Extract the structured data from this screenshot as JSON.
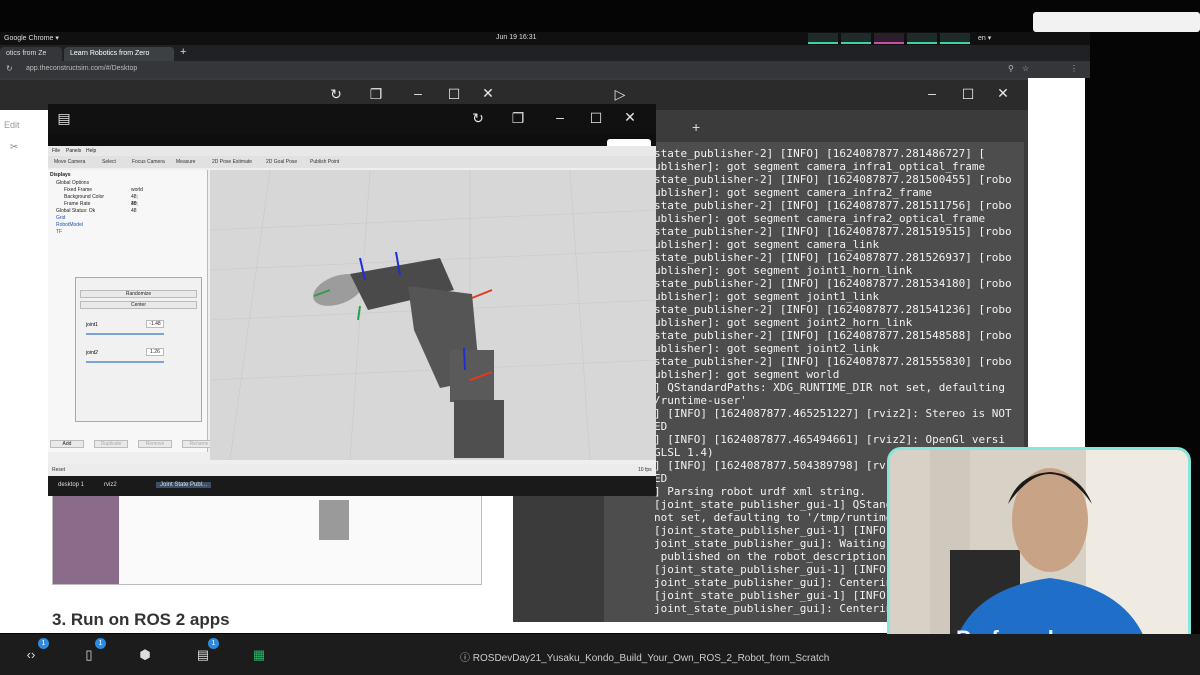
{
  "system": {
    "activities": "Google Chrome ▾",
    "clock": "Jun 19  16:31",
    "lang": "en ▾"
  },
  "browser": {
    "tabs": [
      {
        "label": "otics from Ze"
      },
      {
        "label": "Learn Robotics from Zero"
      }
    ],
    "url": "app.theconstructsim.com/#/Desktop"
  },
  "doc": {
    "edit_label": "Edit",
    "heading": "3. Run on ROS 2 apps"
  },
  "rviz": {
    "menu": [
      "File",
      "Panels",
      "Help"
    ],
    "tools": [
      "Move Camera",
      "Select",
      "Focus Camera",
      "Measure",
      "2D Pose Estimate",
      "2D Goal Pose",
      "Publish Point"
    ],
    "displays_title": "Displays",
    "tree": [
      {
        "label": "Global Options",
        "value": ""
      },
      {
        "label": "Fixed Frame",
        "value": "world"
      },
      {
        "label": "Background Color",
        "value": "48; 48; 48"
      },
      {
        "label": "Frame Rate",
        "value": "30"
      },
      {
        "label": "Global Status: Ok",
        "value": ""
      },
      {
        "label": "Grid",
        "value": ""
      },
      {
        "label": "RobotModel",
        "value": ""
      },
      {
        "label": "TF",
        "value": ""
      }
    ],
    "jsp": {
      "randomize": "Randomize",
      "center": "Center",
      "joints": [
        {
          "name": "joint1",
          "value": "-1.48"
        },
        {
          "name": "joint2",
          "value": "1.26"
        }
      ]
    },
    "buttons": [
      "Add",
      "Duplicate",
      "Remove",
      "Rename"
    ],
    "status": "Reset",
    "fps": "10 fps",
    "taskbar": [
      {
        "label": "desktop 1"
      },
      {
        "label": "rviz2"
      },
      {
        "label": "Joint State Publ..."
      }
    ]
  },
  "terminal": {
    "lines": [
      "state_publisher-2] [INFO] [1624087877.281486727] [",
      "ublisher]: got segment camera_infra1_optical_frame",
      "state_publisher-2] [INFO] [1624087877.281500455] [robo",
      "ublisher]: got segment camera_infra2_frame",
      "state_publisher-2] [INFO] [1624087877.281511756] [robo",
      "ublisher]: got segment camera_infra2_optical_frame",
      "state_publisher-2] [INFO] [1624087877.281519515] [robo",
      "ublisher]: got segment camera_link",
      "state_publisher-2] [INFO] [1624087877.281526937] [robo",
      "ublisher]: got segment joint1_horn_link",
      "state_publisher-2] [INFO] [1624087877.281534180] [robo",
      "ublisher]: got segment joint1_link",
      "state_publisher-2] [INFO] [1624087877.281541236] [robo",
      "ublisher]: got segment joint2_horn_link",
      "state_publisher-2] [INFO] [1624087877.281548588] [robo",
      "ublisher]: got segment joint2_link",
      "state_publisher-2] [INFO] [1624087877.281555830] [robo",
      "ublisher]: got segment world",
      "] QStandardPaths: XDG_RUNTIME_DIR not set, defaulting",
      "/runtime-user'",
      "] [INFO] [1624087877.465251227] [rviz2]: Stereo is NOT",
      "ED",
      "] [INFO] [1624087877.465494661] [rviz2]: OpenGl versi",
      "GLSL 1.4)",
      "] [INFO] [1624087877.504389798] [rv",
      "ED",
      "] Parsing robot urdf xml string.",
      "[joint_state_publisher_gui-1] QStandardPat",
      "not set, defaulting to '/tmp/runtime-user'",
      "[joint_state_publisher_gui-1] [INFO] [162",
      "joint_state_publisher_gui]: Waiting for rob",
      " published on the robot_description topic.",
      "[joint_state_publisher_gui-1] [INFO] [162",
      "joint_state_publisher_gui]: Centering",
      "[joint_state_publisher_gui-1] [INFO] [162",
      "joint_state_publisher_gui]: Centering"
    ]
  },
  "taskbar": {
    "title": "ⓘ  ROSDevDay21_Yusaku_Kondo_Build_Your_Own_ROS_2_Robot_from_Scratch",
    "badges": [
      "1",
      "1",
      "1"
    ]
  },
  "webcam": {
    "shirt_text": "Preferred"
  },
  "colors": {
    "terminal_bg": "#4d4d4d",
    "accent": "#86e6dc",
    "badge": "#2a8be0"
  }
}
